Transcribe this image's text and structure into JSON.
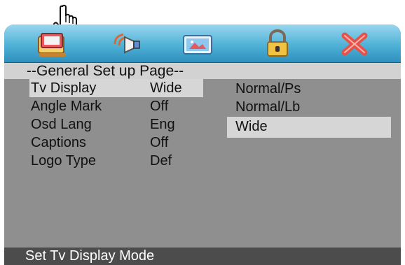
{
  "osd": {
    "title": "--General Set up Page--",
    "tabs": [
      {
        "name": "general-setup-tab-icon",
        "selected": true
      },
      {
        "name": "audio-setup-tab-icon",
        "selected": false
      },
      {
        "name": "video-setup-tab-icon",
        "selected": false
      },
      {
        "name": "password-lock-tab-icon",
        "selected": false
      },
      {
        "name": "exit-close-tab-icon",
        "selected": false
      }
    ],
    "menu": [
      {
        "label": "Tv Display",
        "value": "Wide",
        "selected": true
      },
      {
        "label": "Angle Mark",
        "value": "Off",
        "selected": false
      },
      {
        "label": "Osd Lang",
        "value": "Eng",
        "selected": false
      },
      {
        "label": "Captions",
        "value": "Off",
        "selected": false
      },
      {
        "label": "Logo Type",
        "value": "Def",
        "selected": false
      }
    ],
    "options": [
      {
        "label": "Normal/Ps",
        "selected": false
      },
      {
        "label": "Normal/Lb",
        "selected": false
      },
      {
        "label": "Wide",
        "selected": true
      }
    ],
    "status": "Set Tv Display Mode"
  },
  "colors": {
    "menu_background": "#8f8f8f",
    "selected_row": "#d6d6d6",
    "status_bar": "#4c4c4c",
    "top_bar": "#4fb2d6"
  },
  "icons": {
    "pointer": "hand-pointer-icon"
  }
}
